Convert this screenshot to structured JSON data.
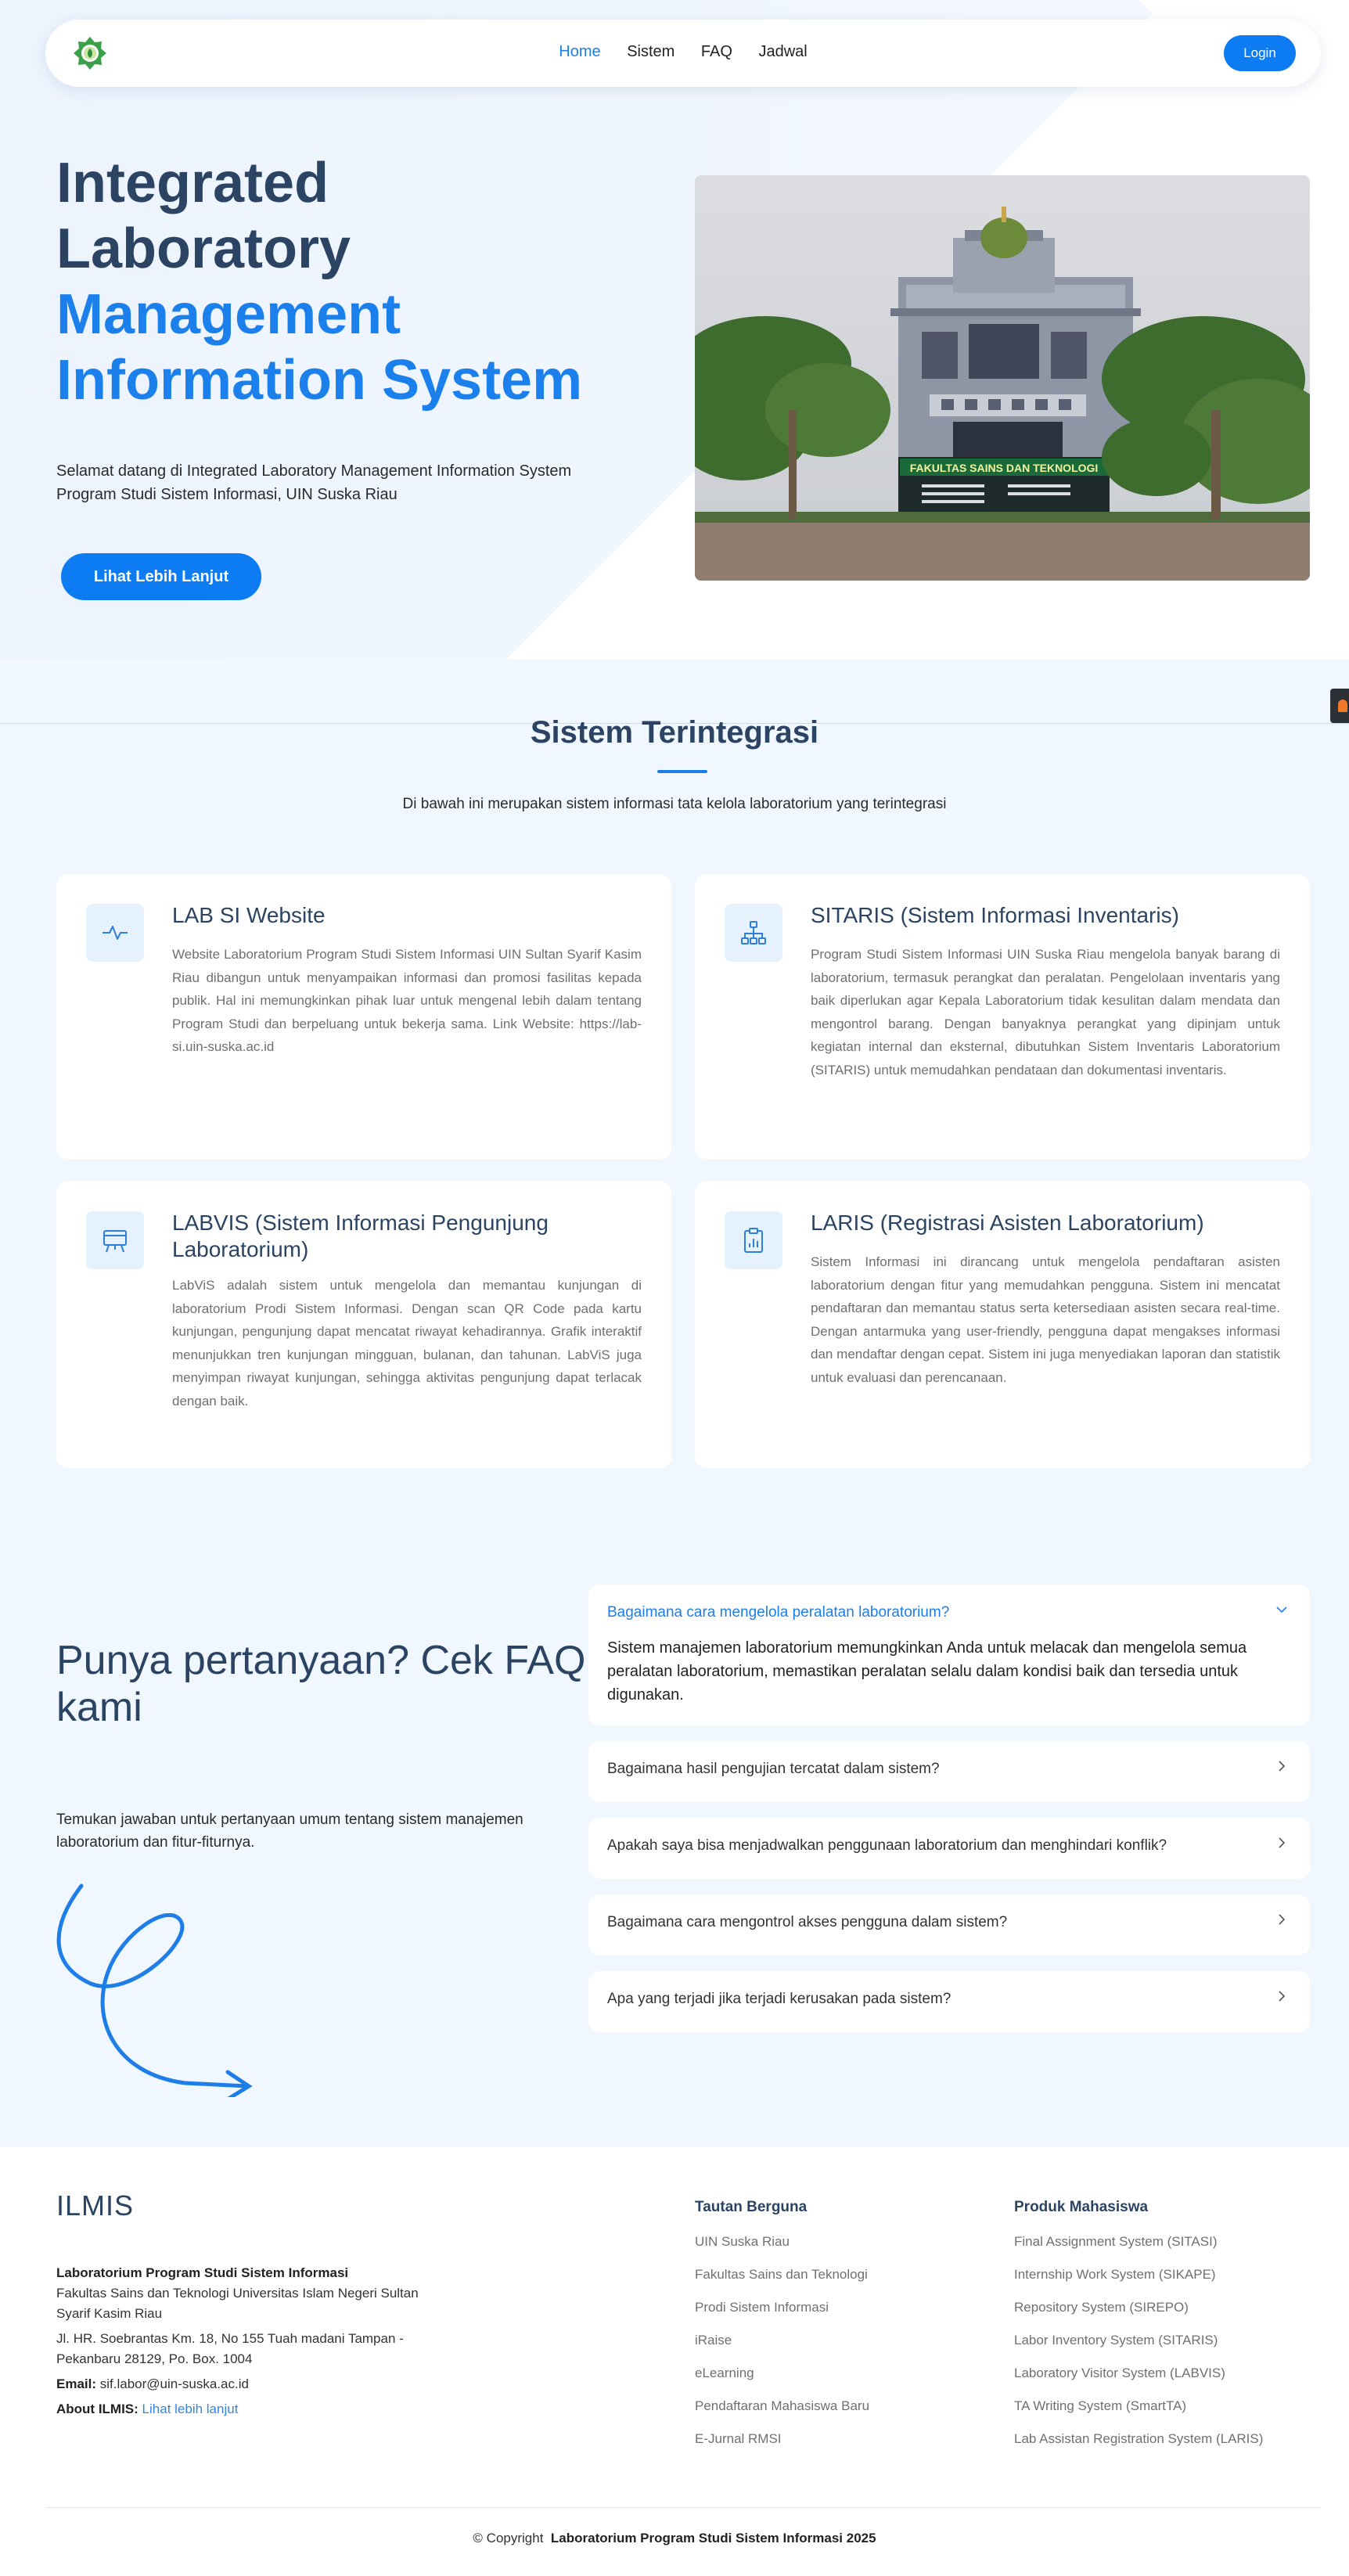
{
  "nav": {
    "logo": "leaf-emblem-logo",
    "links": [
      "Home",
      "Sistem",
      "FAQ",
      "Jadwal"
    ],
    "active": "Home",
    "login": "Login"
  },
  "hero": {
    "title_dark_1": "Integrated",
    "title_dark_2": "Laboratory",
    "title_blue_1": "Management",
    "title_blue_2": "Information System",
    "subtitle": "Selamat datang di Integrated Laboratory Management Information System Program Studi Sistem Informasi, UIN Suska Riau",
    "button": "Lihat Lebih Lanjut",
    "building_sign": "FAKULTAS SAINS DAN TEKNOLOGI"
  },
  "systems": {
    "title": "Sistem Terintegrasi",
    "description": "Di bawah ini merupakan sistem informasi tata kelola laboratorium yang terintegrasi",
    "cards": [
      {
        "icon": "activity-icon",
        "title": "LAB SI Website",
        "text": "Website Laboratorium Program Studi Sistem Informasi UIN Sultan Syarif Kasim Riau dibangun untuk menyampaikan informasi dan promosi fasilitas kepada publik. Hal ini memungkinkan pihak luar untuk mengenal lebih dalam tentang Program Studi dan berpeluang untuk bekerja sama. Link Website: https://lab-si.uin-suska.ac.id"
      },
      {
        "icon": "network-icon",
        "title": "SITARIS (Sistem Informasi Inventaris)",
        "text": "Program Studi Sistem Informasi UIN Suska Riau mengelola banyak barang di laboratorium, termasuk perangkat dan peralatan. Pengelolaan inventaris yang baik diperlukan agar Kepala Laboratorium tidak kesulitan dalam mendata dan mengontrol barang. Dengan banyaknya perangkat yang dipinjam untuk kegiatan internal dan eksternal, dibutuhkan Sistem Inventaris Laboratorium (SITARIS) untuk memudahkan pendataan dan dokumentasi inventaris."
      },
      {
        "icon": "presentation-board-icon",
        "title": "LABVIS (Sistem Informasi Pengunjung Laboratorium)",
        "text": "LabViS adalah sistem untuk mengelola dan memantau kunjungan di laboratorium Prodi Sistem Informasi. Dengan scan QR Code pada kartu kunjungan, pengunjung dapat mencatat riwayat kehadirannya. Grafik interaktif menunjukkan tren kunjungan mingguan, bulanan, dan tahunan. LabViS juga menyimpan riwayat kunjungan, sehingga aktivitas pengunjung dapat terlacak dengan baik."
      },
      {
        "icon": "clipboard-chart-icon",
        "title": "LARIS (Registrasi Asisten Laboratorium)",
        "text": "Sistem Informasi ini dirancang untuk mengelola pendaftaran asisten laboratorium dengan fitur yang memudahkan pengguna. Sistem ini mencatat pendaftaran dan memantau status serta ketersediaan asisten secara real-time. Dengan antarmuka yang user-friendly, pengguna dapat mengakses informasi dan mendaftar dengan cepat. Sistem ini juga menyediakan laporan dan statistik untuk evaluasi dan perencanaan."
      }
    ]
  },
  "faq": {
    "title": "Punya pertanyaan? Cek FAQ kami",
    "subtitle": "Temukan jawaban untuk pertanyaan umum tentang sistem manajemen laboratorium dan fitur-fiturnya.",
    "items": [
      {
        "question": "Bagaimana cara mengelola peralatan laboratorium?",
        "answer": "Sistem manajemen laboratorium memungkinkan Anda untuk melacak dan mengelola semua peralatan laboratorium, memastikan peralatan selalu dalam kondisi baik dan tersedia untuk digunakan.",
        "open": true
      },
      {
        "question": "Bagaimana hasil pengujian tercatat dalam sistem?",
        "open": false
      },
      {
        "question": "Apakah saya bisa menjadwalkan penggunaan laboratorium dan menghindari konflik?",
        "open": false
      },
      {
        "question": "Bagaimana cara mengontrol akses pengguna dalam sistem?",
        "open": false
      },
      {
        "question": "Apa yang terjadi jika terjadi kerusakan pada sistem?",
        "open": false
      }
    ]
  },
  "footer": {
    "brand": "ILMIS",
    "org": "Laboratorium Program Studi Sistem Informasi",
    "faculty": "Fakultas Sains dan Teknologi Universitas Islam Negeri Sultan Syarif Kasim Riau",
    "address": "Jl. HR. Soebrantas Km. 18, No 155 Tuah madani Tampan - Pekanbaru 28129, Po. Box. 1004",
    "email_label": "Email:",
    "email": "sif.labor@uin-suska.ac.id",
    "about_label": "About ILMIS:",
    "about_link": "Lihat lebih lanjut",
    "col1_title": "Tautan Berguna",
    "col1_links": [
      "UIN Suska Riau",
      "Fakultas Sains dan Teknologi",
      "Prodi Sistem Informasi",
      "iRaise",
      "eLearning",
      "Pendaftaran Mahasiswa Baru",
      "E-Jurnal RMSI"
    ],
    "col2_title": "Produk Mahasiswa",
    "col2_links": [
      "Final Assignment System (SITASI)",
      "Internship Work System (SIKAPE)",
      "Repository System (SIREPO)",
      "Labor Inventory System (SITARIS)",
      "Laboratory Visitor System (LABVIS)",
      "TA Writing System (SmartTA)",
      "Lab Assistan Registration System (LARIS)"
    ],
    "copyright_prefix": "© Copyright",
    "copyright_org": "Laboratorium Program Studi Sistem Informasi 2025"
  },
  "colors": {
    "accent": "#1e7ee8",
    "button": "#0d7cf2",
    "heading": "#2b4463",
    "page_bg": "#f1f7ff"
  }
}
